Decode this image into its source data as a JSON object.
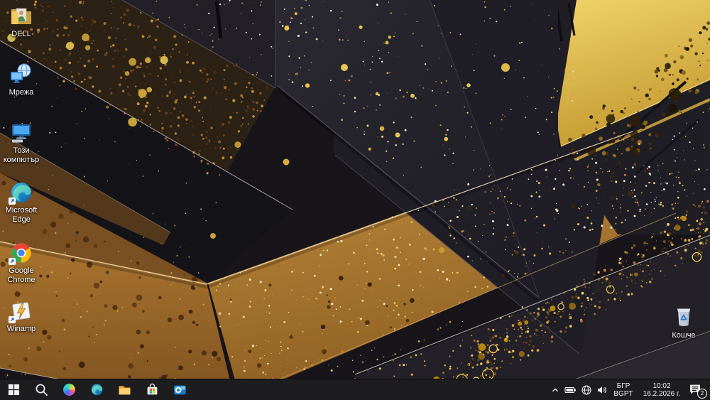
{
  "desktop": {
    "icons": [
      {
        "name": "dell-user-folder",
        "label": "DELL"
      },
      {
        "name": "network",
        "label": "Мрежа"
      },
      {
        "name": "this-pc",
        "label": "Този компютър"
      },
      {
        "name": "microsoft-edge",
        "label": "Microsoft Edge"
      },
      {
        "name": "google-chrome",
        "label": "Google Chrome"
      },
      {
        "name": "winamp",
        "label": "Winamp"
      },
      {
        "name": "recycle-bin",
        "label": "Кошче"
      }
    ]
  },
  "taskbar": {
    "buttons": [
      {
        "icon": "windows-start"
      },
      {
        "icon": "search"
      },
      {
        "icon": "copilot"
      },
      {
        "icon": "microsoft-edge"
      },
      {
        "icon": "file-explorer"
      },
      {
        "icon": "microsoft-store"
      },
      {
        "icon": "outlook"
      }
    ],
    "tray": {
      "icons": [
        "chevron-up",
        "battery",
        "network-globe",
        "volume"
      ],
      "language_line1": "БГР",
      "language_line2": "BGPT",
      "time": "10:02",
      "date": "16.2.2026 г.",
      "notification_count": "2"
    }
  },
  "colors": {
    "taskbar_bg": "#1d1d1f",
    "gold": "#d9b13e",
    "copper": "#9a6a30",
    "label_text": "#ffffff"
  }
}
